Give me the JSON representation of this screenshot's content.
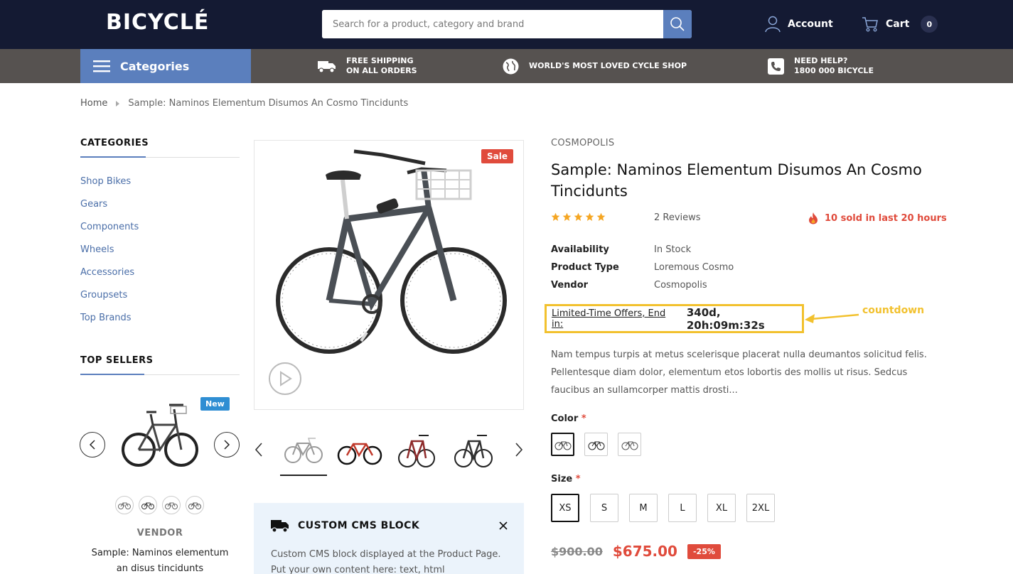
{
  "header": {
    "logo": "BICYCLÉ",
    "search_placeholder": "Search for a product, category and brand",
    "account_label": "Account",
    "cart_label": "Cart",
    "cart_count": "0"
  },
  "nav": {
    "categories_label": "Categories",
    "features": [
      {
        "line1": "FREE SHIPPING",
        "line2": "ON ALL ORDERS",
        "icon": "truck-icon"
      },
      {
        "line1": "WORLD'S MOST LOVED CYCLE SHOP",
        "line2": "",
        "icon": "globe-icon"
      },
      {
        "line1": "NEED HELP?",
        "line2": "1800 000 BICYCLE",
        "icon": "phone-icon"
      }
    ]
  },
  "breadcrumb": {
    "home": "Home",
    "current": "Sample: Naminos Elementum Disumos An Cosmo Tincidunts"
  },
  "sidebar": {
    "categories_title": "CATEGORIES",
    "categories": [
      "Shop Bikes",
      "Gears",
      "Components",
      "Wheels",
      "Accessories",
      "Groupsets",
      "Top Brands"
    ],
    "top_sellers_title": "TOP SELLERS",
    "top_seller": {
      "badge": "New",
      "vendor": "VENDOR",
      "name_line1": "Sample: Naminos elementum",
      "name_line2": "an disus tincidunts"
    }
  },
  "gallery": {
    "sale_badge": "Sale"
  },
  "cms_block": {
    "title": "CUSTOM CMS BLOCK",
    "text": "Custom CMS block displayed at the Product Page. Put your own content here: text, html"
  },
  "product": {
    "vendor": "COSMOPOLIS",
    "title": "Sample: Naminos Elementum Disumos An Cosmo Tincidunts",
    "rating": 5,
    "reviews": "2 Reviews",
    "sold_note": "10 sold in last 20 hours",
    "meta": [
      {
        "key": "Availability",
        "value": "In Stock"
      },
      {
        "key": "Product Type",
        "value": "Loremous Cosmo"
      },
      {
        "key": "Vendor",
        "value": "Cosmopolis"
      }
    ],
    "countdown_label": "Limited-Time Offers, End in:",
    "countdown_value": "340d, 20h:09m:32s",
    "annotation": "countdown",
    "description": "Nam tempus turpis at metus scelerisque placerat nulla deumantos solicitud felis. Pellentesque diam dolor, elementum etos lobortis des mollis ut risus. Sedcus faucibus an sullamcorper mattis drosti...",
    "color_label": "Color",
    "size_label": "Size",
    "required_mark": "*",
    "sizes": [
      "XS",
      "S",
      "M",
      "L",
      "XL",
      "2XL"
    ],
    "old_price": "$900.00",
    "new_price": "$675.00",
    "discount": "-25%"
  },
  "colors": {
    "accent": "#5b7fbd",
    "header_bg": "#141a33",
    "nav_bg": "#565250",
    "sale": "#e04b3c",
    "star": "#f5a623",
    "highlight": "#f2c12e"
  }
}
